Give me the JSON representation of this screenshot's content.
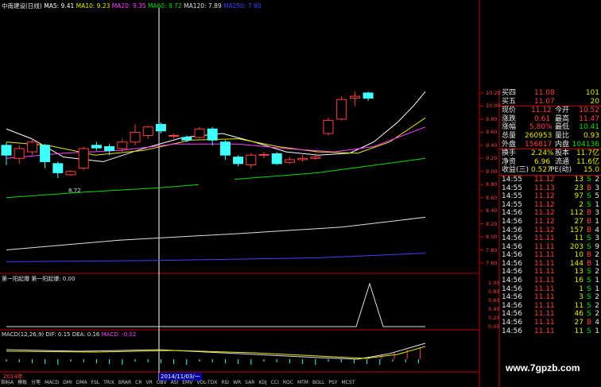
{
  "header": {
    "stock": "中南建设(日线)",
    "ma5": "MA5: 9.41",
    "ma10": "MA10: 9.23",
    "ma20": "MA20: 9.35",
    "ma60": "MA60: 8.72",
    "ma120": "MA120: 7.89",
    "ma250": "MA250: 7.60"
  },
  "colors": {
    "ma5": "#ffffff",
    "ma10": "#e8e800",
    "ma20": "#ff40ff",
    "ma60": "#00e000",
    "ma120": "#e0e0e0",
    "ma250": "#4040ff",
    "up": "#ff4040",
    "down": "#40ffff"
  },
  "price_axis": [
    "10.20",
    "10.00",
    "9.80",
    "9.60",
    "9.40",
    "9.20",
    "9.00",
    "8.80",
    "8.60",
    "8.40",
    "8.20",
    "8.00",
    "7.80",
    "7.60"
  ],
  "low_label": "8.72",
  "indicator1": {
    "title": "第一阳起爆 第一阳起爆: 0.00",
    "axis": [
      "1.00",
      "0.80",
      "0.60",
      "0.40",
      "0.20",
      "0.00"
    ]
  },
  "macd": {
    "title": "MACD(12,26,9) DIF: 0.15 DEA: 0.16",
    "macd_val": "MACD: -0.02"
  },
  "date_left": "2014年",
  "date_cursor": "2014/11/03/一",
  "quote": {
    "ask4": {
      "label": "买四",
      "price": "11.08",
      "vol": "101"
    },
    "ask5": {
      "label": "买五",
      "price": "11.07",
      "vol": "20"
    },
    "now": {
      "label": "现价",
      "val": "11.12",
      "label2": "今开",
      "val2": "10.52"
    },
    "change": {
      "label": "涨跌",
      "val": "0.61",
      "label2": "最高",
      "val2": "11.47"
    },
    "pct": {
      "label": "涨幅",
      "val": "5.80%",
      "label2": "最低",
      "val2": "10.41"
    },
    "total": {
      "label": "总量",
      "val": "260953",
      "label2": "量比",
      "val2": "0.93"
    },
    "outer": {
      "label": "外盘",
      "val": "156817",
      "label2": "内盘",
      "val2": "104136"
    },
    "turnover": {
      "label": "换手",
      "val": "2.24%",
      "label2": "股本",
      "val2": "11.7亿"
    },
    "net": {
      "label": "净资",
      "val": "6.96",
      "label2": "流通",
      "val2": "11.6亿"
    },
    "income": {
      "label": "收益(三)",
      "val": "0.527",
      "label2": "PE(动)",
      "val2": "15.0"
    }
  },
  "ticks": [
    {
      "t": "14:55",
      "p": "11.12",
      "v": "13",
      "d": "S",
      "n": "2"
    },
    {
      "t": "14:55",
      "p": "11.13",
      "v": "23",
      "d": "B",
      "n": "3"
    },
    {
      "t": "14:55",
      "p": "11.12",
      "v": "97",
      "d": "S",
      "n": "5"
    },
    {
      "t": "14:55",
      "p": "11.12",
      "v": "2",
      "d": "S",
      "n": "1"
    },
    {
      "t": "14:56",
      "p": "11.12",
      "v": "112",
      "d": "B",
      "n": "3"
    },
    {
      "t": "14:56",
      "p": "11.12",
      "v": "27",
      "d": "B",
      "n": "1"
    },
    {
      "t": "14:56",
      "p": "11.12",
      "v": "157",
      "d": "B",
      "n": "4"
    },
    {
      "t": "14:56",
      "p": "11.11",
      "v": "11",
      "d": "S",
      "n": "3"
    },
    {
      "t": "14:56",
      "p": "11.11",
      "v": "203",
      "d": "S",
      "n": "9"
    },
    {
      "t": "14:56",
      "p": "11.11",
      "v": "10",
      "d": "B",
      "n": "2"
    },
    {
      "t": "14:56",
      "p": "11.11",
      "v": "144",
      "d": "B",
      "n": "1"
    },
    {
      "t": "14:56",
      "p": "11.11",
      "v": "13",
      "d": "S",
      "n": "2"
    },
    {
      "t": "14:56",
      "p": "11.11",
      "v": "16",
      "d": "S",
      "n": "1"
    },
    {
      "t": "14:56",
      "p": "11.11",
      "v": "1",
      "d": "S",
      "n": "1"
    },
    {
      "t": "14:56",
      "p": "11.11",
      "v": "3",
      "d": "S",
      "n": "2"
    },
    {
      "t": "14:56",
      "p": "11.11",
      "v": "11",
      "d": "S",
      "n": "2"
    },
    {
      "t": "14:56",
      "p": "11.11",
      "v": "46",
      "d": "S",
      "n": "2"
    },
    {
      "t": "14:56",
      "p": "11.11",
      "v": "27",
      "d": "B",
      "n": "4"
    },
    {
      "t": "14:56",
      "p": "11.11",
      "v": "11",
      "d": "S",
      "n": "1"
    }
  ],
  "tabs": [
    "指标A",
    "模板",
    "分笔",
    "MACD",
    "DMI",
    "DMA",
    "FSL",
    "TRIX",
    "BRAR",
    "CR",
    "VR",
    "OBV",
    "ASI",
    "EMV",
    "VOL-TDX",
    "RSI",
    "WR",
    "SAR",
    "KDJ",
    "CCI",
    "ROC",
    "MTM",
    "BOLL",
    "PSY",
    "MCST"
  ],
  "watermark": "www.7gpzb.com",
  "candles": [
    {
      "o": 9.4,
      "c": 9.25,
      "h": 9.45,
      "l": 9.1
    },
    {
      "o": 9.2,
      "c": 9.35,
      "h": 9.4,
      "l": 9.12
    },
    {
      "o": 9.3,
      "c": 9.45,
      "h": 9.5,
      "l": 9.25
    },
    {
      "o": 9.4,
      "c": 9.15,
      "h": 9.42,
      "l": 9.05
    },
    {
      "o": 9.12,
      "c": 8.98,
      "h": 9.15,
      "l": 8.9
    },
    {
      "o": 8.95,
      "c": 9.0,
      "h": 9.02,
      "l": 8.93
    },
    {
      "o": 9.05,
      "c": 9.35,
      "h": 9.38,
      "l": 9.02
    },
    {
      "o": 9.4,
      "c": 9.36,
      "h": 9.45,
      "l": 9.32
    },
    {
      "o": 9.38,
      "c": 9.32,
      "h": 9.42,
      "l": 9.25
    },
    {
      "o": 9.35,
      "c": 9.45,
      "h": 9.5,
      "l": 9.3
    },
    {
      "o": 9.45,
      "c": 9.6,
      "h": 9.72,
      "l": 9.4
    },
    {
      "o": 9.55,
      "c": 9.68,
      "h": 9.7,
      "l": 9.5
    },
    {
      "o": 9.72,
      "c": 9.62,
      "h": 9.75,
      "l": 9.58
    },
    {
      "o": 9.55,
      "c": 9.55,
      "h": 9.58,
      "l": 9.5
    },
    {
      "o": 9.52,
      "c": 9.48,
      "h": 9.55,
      "l": 9.45
    },
    {
      "o": 9.52,
      "c": 9.65,
      "h": 9.68,
      "l": 9.5
    },
    {
      "o": 9.65,
      "c": 9.48,
      "h": 9.68,
      "l": 9.4
    },
    {
      "o": 9.45,
      "c": 9.25,
      "h": 9.48,
      "l": 9.18
    },
    {
      "o": 9.22,
      "c": 9.12,
      "h": 9.25,
      "l": 9.08
    },
    {
      "o": 9.1,
      "c": 9.25,
      "h": 9.28,
      "l": 9.05
    },
    {
      "o": 9.25,
      "c": 9.26,
      "h": 9.3,
      "l": 9.2
    },
    {
      "o": 9.27,
      "c": 9.12,
      "h": 9.3,
      "l": 9.1
    },
    {
      "o": 9.14,
      "c": 9.18,
      "h": 9.22,
      "l": 9.12
    },
    {
      "o": 9.18,
      "c": 9.2,
      "h": 9.25,
      "l": 9.15
    },
    {
      "o": 9.2,
      "c": 9.22,
      "h": 9.28,
      "l": 9.18
    },
    {
      "o": 9.58,
      "c": 9.78,
      "h": 9.82,
      "l": 9.55
    },
    {
      "o": 9.8,
      "c": 10.1,
      "h": 10.15,
      "l": 9.78
    },
    {
      "o": 10.12,
      "c": 10.15,
      "h": 10.22,
      "l": 10.0
    },
    {
      "o": 10.2,
      "c": 10.12,
      "h": 10.22,
      "l": 10.08
    }
  ]
}
